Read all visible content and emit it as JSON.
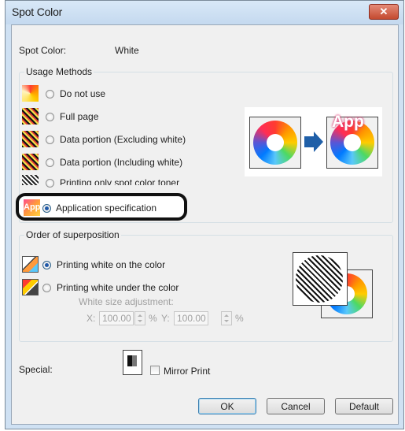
{
  "window": {
    "title": "Spot Color"
  },
  "spot_color": {
    "label": "Spot Color:",
    "value": "White"
  },
  "usage_methods": {
    "title": "Usage Methods",
    "options": [
      {
        "label": "Do not use",
        "selected": false,
        "icon": "gradient-icon"
      },
      {
        "label": "Full page",
        "selected": false,
        "icon": "hatched-color-icon"
      },
      {
        "label": "Data portion (Excluding white)",
        "selected": false,
        "icon": "hatched-color-icon"
      },
      {
        "label": "Data portion (Including white)",
        "selected": false,
        "icon": "hatched-color-icon"
      },
      {
        "label": "Printing only spot color toner",
        "selected": false,
        "icon": "hatched-icon"
      },
      {
        "label": "Application specification",
        "selected": true,
        "icon": "app-icon"
      }
    ],
    "preview_app_text": "App"
  },
  "superposition": {
    "title": "Order of superposition",
    "options": [
      {
        "label": "Printing white on the color",
        "selected": true
      },
      {
        "label": "Printing white under the color",
        "selected": false
      }
    ],
    "white_size_label": "White size adjustment:",
    "x_label": "X:",
    "x_value": "100.00",
    "x_unit": "%",
    "y_label": "Y:",
    "y_value": "100.00",
    "y_unit": "%"
  },
  "special": {
    "label": "Special:",
    "mirror_label": "Mirror Print",
    "mirror_checked": false
  },
  "buttons": {
    "ok": "OK",
    "cancel": "Cancel",
    "default": "Default"
  }
}
